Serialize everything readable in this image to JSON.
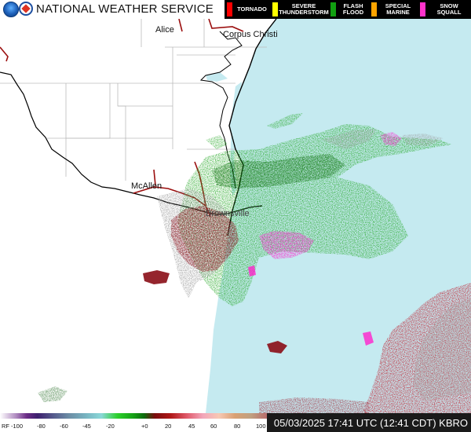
{
  "header": {
    "agency_name": "NATIONAL WEATHER SERVICE",
    "logos": [
      "noaa-logo",
      "nws-logo"
    ]
  },
  "warning_legend": [
    {
      "label": "TORNADO",
      "color": "#ff0000"
    },
    {
      "label": "SEVERE\nTHUNDERSTORM",
      "color": "#ffff00"
    },
    {
      "label": "FLASH\nFLOOD",
      "color": "#11a011"
    },
    {
      "label": "SPECIAL\nMARINE",
      "color": "#ffa500"
    },
    {
      "label": "SNOW\nSQUALL",
      "color": "#ff33cc"
    }
  ],
  "map": {
    "cities": [
      {
        "name": "Alice"
      },
      {
        "name": "Corpus Christi"
      },
      {
        "name": "McAllen"
      },
      {
        "name": "Brownsville"
      }
    ],
    "colors": {
      "water": "#c5eaf0",
      "land": "#ffffff",
      "county_lines": "#bbbbbb",
      "border": "#000000",
      "highways": "#9b0f0f"
    }
  },
  "footer": {
    "product_label": "RF",
    "scale_ticks": [
      "-100",
      "-80",
      "-60",
      "-45",
      "-20",
      "+0",
      "20",
      "45",
      "60",
      "80",
      "100"
    ],
    "timestamp": "05/03/2025 17:41 UTC (12:41 CDT) KBRO"
  }
}
